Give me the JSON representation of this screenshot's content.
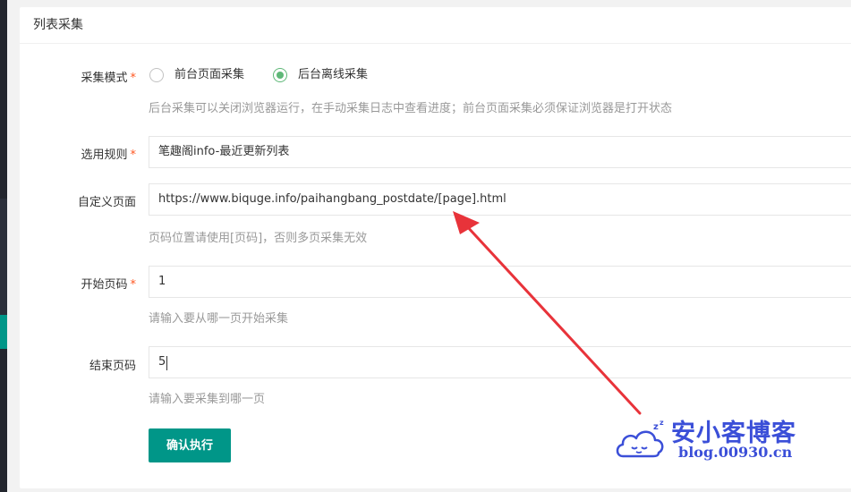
{
  "card": {
    "title": "列表采集"
  },
  "form": {
    "mode": {
      "label": "采集模式",
      "required_mark": "*",
      "options": [
        {
          "label": "前台页面采集",
          "checked": false
        },
        {
          "label": "后台离线采集",
          "checked": true
        }
      ],
      "hint": "后台采集可以关闭浏览器运行，在手动采集日志中查看进度；前台页面采集必须保证浏览器是打开状态"
    },
    "rule": {
      "label": "选用规则",
      "required_mark": "*",
      "value": "笔趣阁info-最近更新列表"
    },
    "custom_page": {
      "label": "自定义页面",
      "value": "https://www.biquge.info/paihangbang_postdate/[page].html",
      "hint": "页码位置请使用[页码]，否则多页采集无效"
    },
    "start_page": {
      "label": "开始页码",
      "required_mark": "*",
      "value": "1",
      "hint": "请输入要从哪一页开始采集"
    },
    "end_page": {
      "label": "结束页码",
      "value": "5",
      "hint": "请输入要采集到哪一页"
    },
    "submit_label": "确认执行"
  },
  "watermark": {
    "title": "安小客博客",
    "url": "blog.00930.cn",
    "icon": "cloud-sleep-icon"
  },
  "colors": {
    "primary": "#009688",
    "radio_checked": "#5fb878",
    "required": "#ff5722",
    "annotation_arrow": "#e8333a",
    "watermark": "#3b4fd8"
  }
}
